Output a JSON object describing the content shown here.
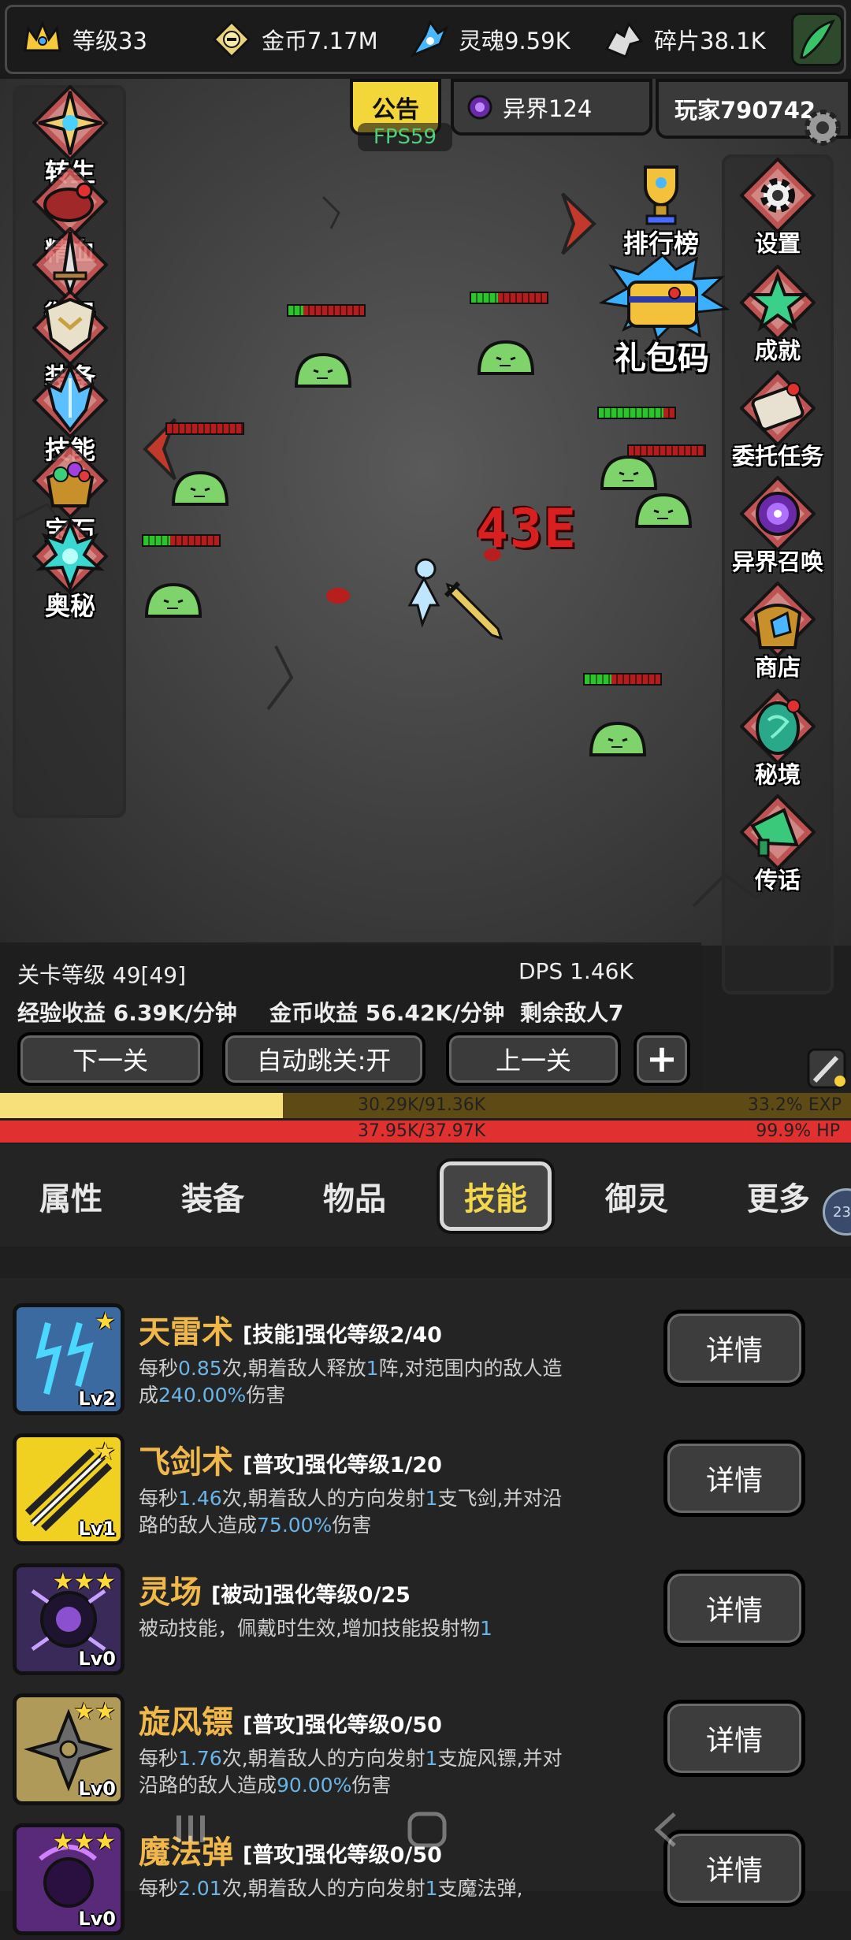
{
  "resources": {
    "level": "等级33",
    "gold": "金币7.17M",
    "soul": "灵魂9.59K",
    "fragment": "碎片38.1K"
  },
  "announce": {
    "label": "公告",
    "fps": "FPS59"
  },
  "otherworld": "异界124",
  "player": "玩家790742",
  "left_menu": [
    "转生",
    "精血",
    "御器",
    "装备",
    "技能",
    "宝石",
    "奥秘"
  ],
  "right_menu": [
    "设置",
    "成就",
    "委托任务",
    "异界召唤",
    "商店",
    "秘境",
    "传话"
  ],
  "leaderboard": "排行榜",
  "giftcode": "礼包码",
  "damage_number": "43E",
  "stats": {
    "stage_level": "关卡等级 49[49]",
    "dps": "DPS 1.46K",
    "exp_income": "经验收益 6.39K/分钟",
    "gold_income": "金币收益 56.42K/分钟",
    "enemies_left": "剩余敌人7"
  },
  "nav": {
    "next": "下一关",
    "auto": "自动跳关:开",
    "prev": "上一关",
    "plus": "+"
  },
  "exp": {
    "text": "30.29K/91.36K",
    "percent": "33.2% EXP",
    "fraction": 0.332
  },
  "hp": {
    "text": "37.95K/37.97K",
    "percent": "99.9%  HP",
    "fraction": 0.999
  },
  "tabs": [
    "属性",
    "装备",
    "物品",
    "技能",
    "御灵",
    "更多"
  ],
  "active_tab": "技能",
  "side_badge": "23",
  "skills": [
    {
      "name": "天雷术",
      "type": "[技能]强化等级2/40",
      "lv": "Lv2",
      "stars": "★",
      "desc": [
        "每秒",
        "0.85",
        "次,朝着敌人释放",
        "1",
        "阵,对范围内的敌人造成",
        "240.00%",
        "伤害"
      ]
    },
    {
      "name": "飞剑术",
      "type": "[普攻]强化等级1/20",
      "lv": "Lv1",
      "stars": "★",
      "desc": [
        "每秒",
        "1.46",
        "次,朝着敌人的方向发射",
        "1",
        "支飞剑,并对沿路的敌人造成",
        "75.00%",
        "伤害"
      ]
    },
    {
      "name": "灵场",
      "type": "[被动]强化等级0/25",
      "lv": "Lv0",
      "stars": "★★★",
      "desc": [
        "被动技能，佩戴时生效,增加技能投射物",
        "1",
        "",
        "",
        "",
        "",
        ""
      ]
    },
    {
      "name": "旋风镖",
      "type": "[普攻]强化等级0/50",
      "lv": "Lv0",
      "stars": "★★",
      "desc": [
        "每秒",
        "1.76",
        "次,朝着敌人的方向发射",
        "1",
        "支旋风镖,并对沿路的敌人造成",
        "90.00%",
        "伤害"
      ]
    },
    {
      "name": "魔法弹",
      "type": "[普攻]强化等级0/50",
      "lv": "Lv0",
      "stars": "★★★",
      "desc": [
        "每秒",
        "2.01",
        "次,朝着敌人的方向发射",
        "1",
        "支魔法弹,",
        "",
        ""
      ]
    }
  ],
  "detail_label": "详情",
  "colors": {
    "accent_gold": "#f5d84a",
    "skill_name": "#f0b84a",
    "highlight": "#6ab4e8",
    "exp": "#f7e07a",
    "hp": "#e03030"
  }
}
